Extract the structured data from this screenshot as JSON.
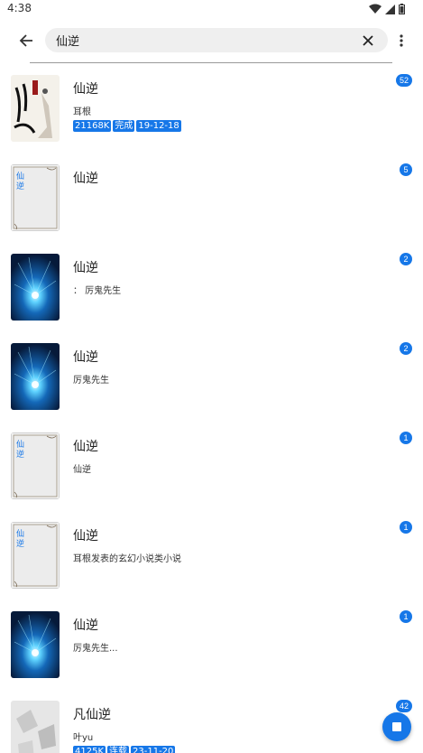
{
  "status_bar": {
    "time": "4:38",
    "icons": [
      "wifi-icon",
      "cell-signal-icon",
      "battery-icon"
    ]
  },
  "search": {
    "value": "仙逆"
  },
  "colors": {
    "accent": "#1677e8"
  },
  "results": [
    {
      "title": "仙逆",
      "author": "耳根",
      "tags": [
        "21168K",
        "完成",
        "19-12-18"
      ],
      "count": "52",
      "cover": "calligraphy"
    },
    {
      "title": "仙逆",
      "author": "",
      "tags": [],
      "count": "5",
      "cover": "paper"
    },
    {
      "title": "仙逆",
      "author": "：  厉鬼先生",
      "tags": [],
      "count": "2",
      "cover": "galaxy"
    },
    {
      "title": "仙逆",
      "author": "厉鬼先生",
      "tags": [],
      "count": "2",
      "cover": "galaxy"
    },
    {
      "title": "仙逆",
      "author": "仙逆",
      "tags": [],
      "count": "1",
      "cover": "paper"
    },
    {
      "title": "仙逆",
      "author": "耳根发表的玄幻小说类小说",
      "tags": [],
      "count": "1",
      "cover": "paper"
    },
    {
      "title": "仙逆",
      "author": "厉鬼先生...",
      "tags": [],
      "count": "1",
      "cover": "galaxy"
    },
    {
      "title": "凡仙逆",
      "author": "叶yu",
      "tags": [
        "4125K",
        "连载",
        "23-11-20"
      ],
      "count": "42",
      "cover": "grey"
    }
  ],
  "cover_text": "仙逆"
}
